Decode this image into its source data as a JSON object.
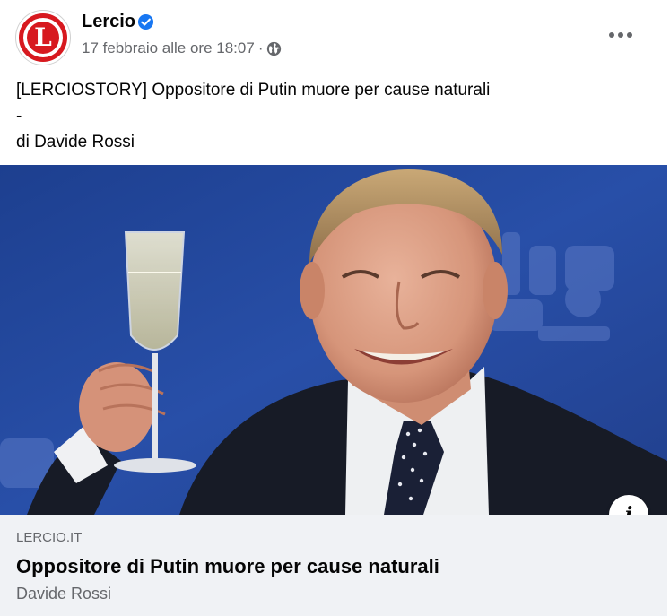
{
  "post": {
    "page_name": "Lercio",
    "avatar_letter": "L",
    "timestamp": "17 febbraio alle ore 18:07",
    "separator": "·",
    "privacy_icon": "globe-icon",
    "verified_icon": "verified-badge-icon",
    "more_icon": "more-options-icon",
    "text_lines": [
      "[LERCIOSTORY] Oppositore di Putin muore per cause naturali",
      "-",
      "di Davide Rossi"
    ]
  },
  "link_preview": {
    "domain": "LERCIO.IT",
    "title": "Oppositore di Putin muore per cause naturali",
    "author": "Davide Rossi",
    "info_icon": "i",
    "image_description_icon": "photo-man-raising-champagne-glass"
  },
  "colors": {
    "brand_red": "#d7191f",
    "verified_blue": "#1877f2",
    "secondary_text": "#65676b",
    "footer_bg": "#f0f2f5"
  }
}
